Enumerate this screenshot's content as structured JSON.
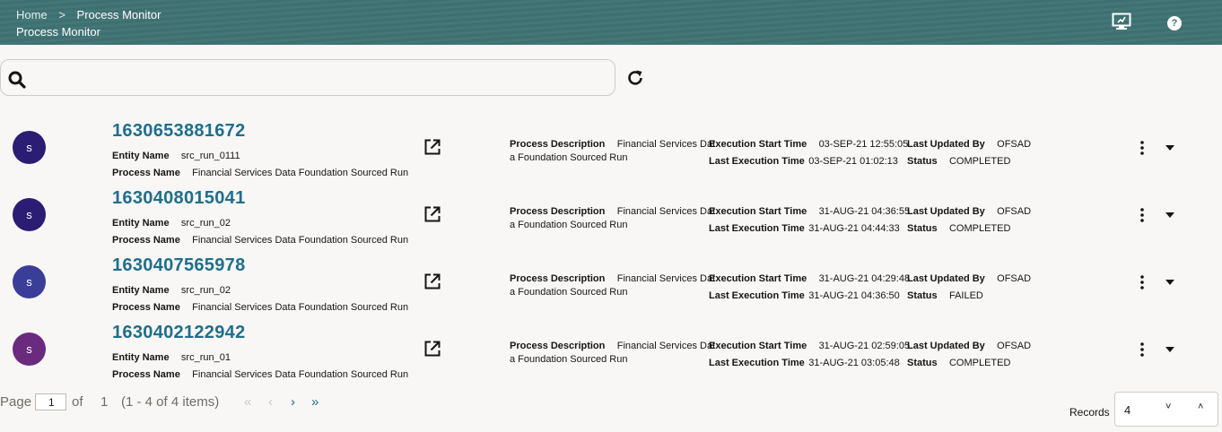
{
  "header": {
    "breadcrumb_home": "Home",
    "breadcrumb_separator": ">",
    "breadcrumb_current": "Process Monitor",
    "page_title": "Process Monitor",
    "help_label": "?"
  },
  "search": {
    "value": "",
    "placeholder": ""
  },
  "labels": {
    "entity_name": "Entity Name",
    "process_name": "Process Name",
    "process_description": "Process Description",
    "execution_start_time": "Execution Start Time",
    "last_execution_time": "Last Execution Time",
    "last_updated_by": "Last Updated By",
    "status": "Status"
  },
  "runs": [
    {
      "avatar": "s",
      "avatar_color": "#2b1d73",
      "id": "1630653881672",
      "entity_name": "src_run_0111",
      "process_name": "Financial Services Data Foundation Sourced Run",
      "desc_line1": "Financial Services Dat",
      "desc_line2": "a Foundation Sourced Run",
      "start_time": "03-SEP-21 12:55:05",
      "last_exec_time": "03-SEP-21 01:02:13",
      "updated_by": "OFSAD",
      "status": "COMPLETED"
    },
    {
      "avatar": "s",
      "avatar_color": "#2b1d73",
      "id": "1630408015041",
      "entity_name": "src_run_02",
      "process_name": "Financial Services Data Foundation Sourced Run",
      "desc_line1": "Financial Services Dat",
      "desc_line2": "a Foundation Sourced Run",
      "start_time": "31-AUG-21 04:36:55",
      "last_exec_time": "31-AUG-21 04:44:33",
      "updated_by": "OFSAD",
      "status": "COMPLETED"
    },
    {
      "avatar": "s",
      "avatar_color": "#3a3e99",
      "id": "1630407565978",
      "entity_name": "src_run_02",
      "process_name": "Financial Services Data Foundation Sourced Run",
      "desc_line1": "Financial Services Dat",
      "desc_line2": "a Foundation Sourced Run",
      "start_time": "31-AUG-21 04:29:48",
      "last_exec_time": "31-AUG-21 04:36:50",
      "updated_by": "OFSAD",
      "status": "FAILED"
    },
    {
      "avatar": "s",
      "avatar_color": "#6a2a7e",
      "id": "1630402122942",
      "entity_name": "src_run_01",
      "process_name": "Financial Services Data Foundation Sourced Run",
      "desc_line1": "Financial Services Dat",
      "desc_line2": "a Foundation Sourced Run",
      "start_time": "31-AUG-21 02:59:05",
      "last_exec_time": "31-AUG-21 03:05:48",
      "updated_by": "OFSAD",
      "status": "COMPLETED"
    }
  ],
  "pagination": {
    "page_label": "Page",
    "current_page": "1",
    "of_label": "of",
    "total_pages": "1",
    "summary": "(1 - 4 of 4 items)",
    "first_icon": "«",
    "prev_icon": "‹",
    "next_icon": "›",
    "last_icon": "»"
  },
  "records": {
    "label": "Records",
    "value": "4",
    "down_icon": "˅",
    "up_icon": "˄"
  },
  "colors": {
    "header_bg": "#3f7273",
    "link": "#1f6e8c"
  }
}
